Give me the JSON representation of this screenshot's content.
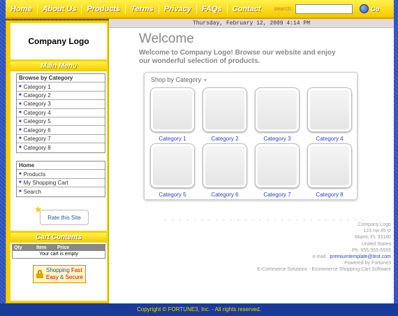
{
  "nav": {
    "items": [
      "Home",
      "About Us",
      "Products",
      "Terms",
      "Privacy",
      "FAQs",
      "Contact"
    ],
    "search_label": "search:",
    "search_value": "",
    "go_label": "Go"
  },
  "logo": {
    "text": "Company Logo"
  },
  "main_menu": {
    "title": "Main Menu",
    "browse_heading": "Browse by Category",
    "categories": [
      "Category 1",
      "Category 2",
      "Category 3",
      "Category 4",
      "Category 5",
      "Category 6",
      "Category 7",
      "Category 8"
    ],
    "links": [
      "Home",
      "Products",
      "My Shopping Cart",
      "Search"
    ]
  },
  "rate": {
    "label": "Rate this Site"
  },
  "cart": {
    "title": "Cart Contents",
    "columns": [
      "Qty",
      "Item",
      "Price"
    ],
    "empty_text": "Your cart is empty"
  },
  "secure_badge": {
    "line1_a": "Shopping",
    "line1_b": "Fast",
    "line2_a": "Easy",
    "line2_b": "&",
    "line2_c": "Secure"
  },
  "datebar": {
    "text": "Thursday, February 12, 2009 4:14 PM"
  },
  "welcome": {
    "title": "Welcome",
    "text": "Welcome to  Company Logo! Browse our website and enjoy our wonderful selection of products."
  },
  "shop": {
    "title": "Shop by Category",
    "categories": [
      "Category 1",
      "Category 2",
      "Category 3",
      "Category 4",
      "Category 5",
      "Category 6",
      "Category 7",
      "Category 8"
    ]
  },
  "footer": {
    "company": "Company Logo",
    "street": "123 nw 45 st",
    "city": "Miami, FL 33180",
    "country": "United States",
    "phone": "Ph: 555-555-5555",
    "email_label": "e-mail :",
    "email": "premiumtemplate@test.com",
    "powered": "Powered by Fortune3",
    "solutions": "E-Commerce Solutions - Ecommerce Shopping Cart Software"
  },
  "copyright": {
    "text": "Copyright © FORTUNE3, Inc. - All rights reserved."
  }
}
